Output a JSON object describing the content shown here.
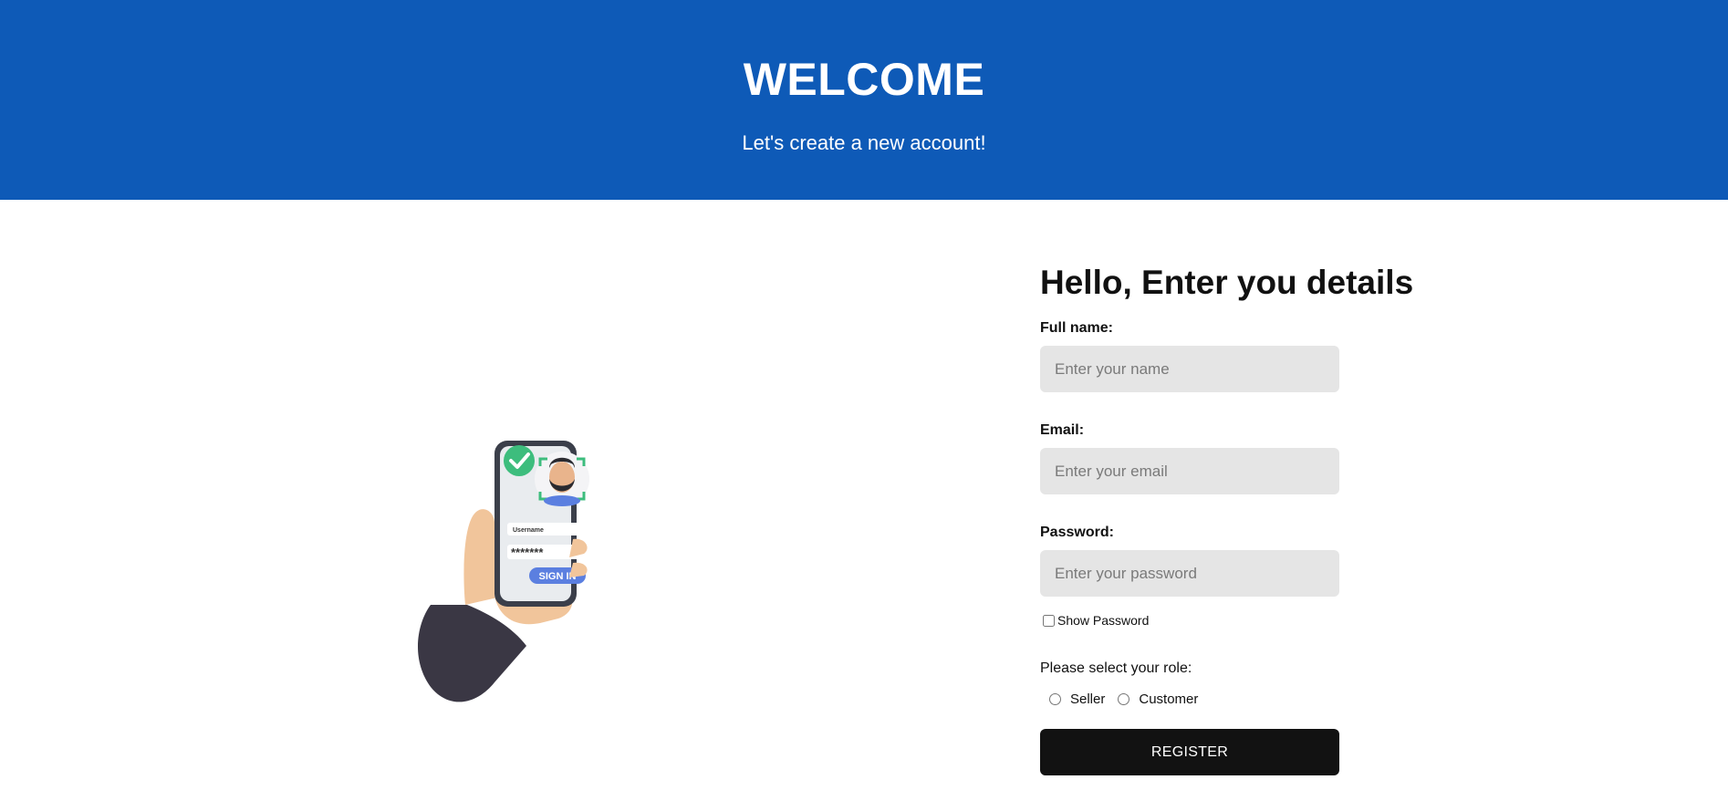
{
  "header": {
    "title": "WELCOME",
    "subtitle": "Let's create a new account!"
  },
  "illustration": {
    "icon": "phone-face-login-illustration",
    "username_label": "Username",
    "password_mask": "*******",
    "signin_label": "SIGN IN",
    "colors": {
      "check": "#3dbd7d",
      "signin": "#5b7fe0",
      "sleeve": "#3a3744",
      "skin": "#f1c59b"
    }
  },
  "form": {
    "title": "Hello, Enter you details",
    "fullname": {
      "label": "Full name:",
      "placeholder": "Enter your name",
      "value": ""
    },
    "email": {
      "label": "Email:",
      "placeholder": "Enter your email",
      "value": ""
    },
    "password": {
      "label": "Password:",
      "placeholder": "Enter your password",
      "value": ""
    },
    "show_password": {
      "label": "Show Password",
      "checked": false
    },
    "role": {
      "label": "Please select your role:",
      "options": [
        "Seller",
        "Customer"
      ],
      "selected": null
    },
    "register_label": "REGISTER"
  },
  "colors": {
    "header_bg": "#0e5ab7",
    "input_bg": "#e5e5e5",
    "button_bg": "#121212"
  }
}
